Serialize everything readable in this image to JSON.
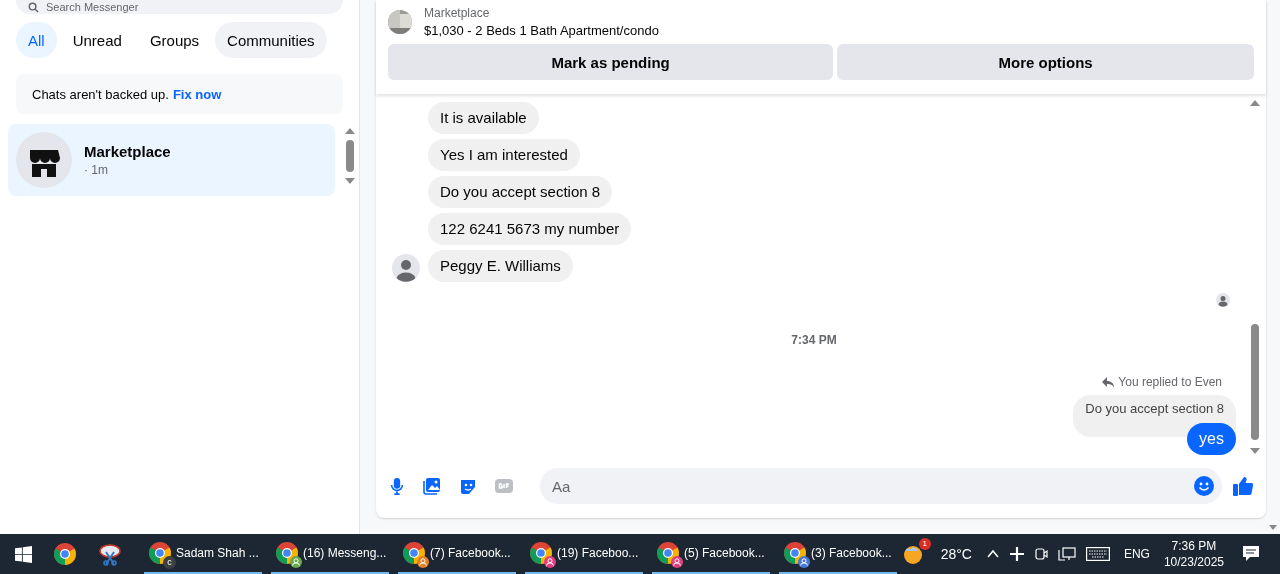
{
  "sidebar": {
    "search": {
      "placeholder": "Search Messenger"
    },
    "filters": [
      {
        "label": "All",
        "selected": true
      },
      {
        "label": "Unread",
        "selected": false
      },
      {
        "label": "Groups",
        "selected": false
      },
      {
        "label": "Communities",
        "selected": false
      }
    ],
    "backup_notice": {
      "text": "Chats aren't backed up.",
      "link": "Fix now"
    },
    "chats": [
      {
        "name": "Marketplace",
        "time": "· 1m",
        "selected": true
      }
    ]
  },
  "conversation": {
    "listing": {
      "source": "Marketplace",
      "title": "$1,030 - 2 Beds 1 Bath Apartment/condo"
    },
    "actions": [
      "Mark as pending",
      "More options"
    ],
    "messages": [
      {
        "kind": "received",
        "text": "It is available",
        "avatar": false
      },
      {
        "kind": "received",
        "text": "Yes I am interested",
        "avatar": false
      },
      {
        "kind": "received",
        "text": "Do you accept section 8",
        "avatar": false
      },
      {
        "kind": "received",
        "text": "122 6241 5673 my number",
        "avatar": false
      },
      {
        "kind": "received",
        "text": "Peggy E. Williams",
        "avatar": true
      },
      {
        "kind": "seen"
      },
      {
        "kind": "timestamp",
        "text": "7:34 PM"
      },
      {
        "kind": "reply_label",
        "text": "You replied to Even"
      },
      {
        "kind": "quoted",
        "text": "Do you accept section 8"
      },
      {
        "kind": "sent",
        "text": "yes"
      }
    ],
    "composer": {
      "placeholder": "Aa"
    }
  },
  "taskbar": {
    "windows": [
      {
        "label": "Sadam Shah ...",
        "badge": "c",
        "color": "#3c4043"
      },
      {
        "label": "(16) Messeng...",
        "color": "#6aa84f"
      },
      {
        "label": "(7) Facebook...",
        "color": "#e67e22"
      },
      {
        "label": "(19) Faceboo...",
        "color": "#e0407f"
      },
      {
        "label": "(5) Facebook...",
        "color": "#e0407f"
      },
      {
        "label": "(3) Facebook...",
        "color": "#4a78d8"
      }
    ],
    "weather": {
      "alert": "1",
      "temperature": "28°C"
    },
    "language": "ENG",
    "time": "7:36 PM",
    "date": "10/23/2025"
  }
}
